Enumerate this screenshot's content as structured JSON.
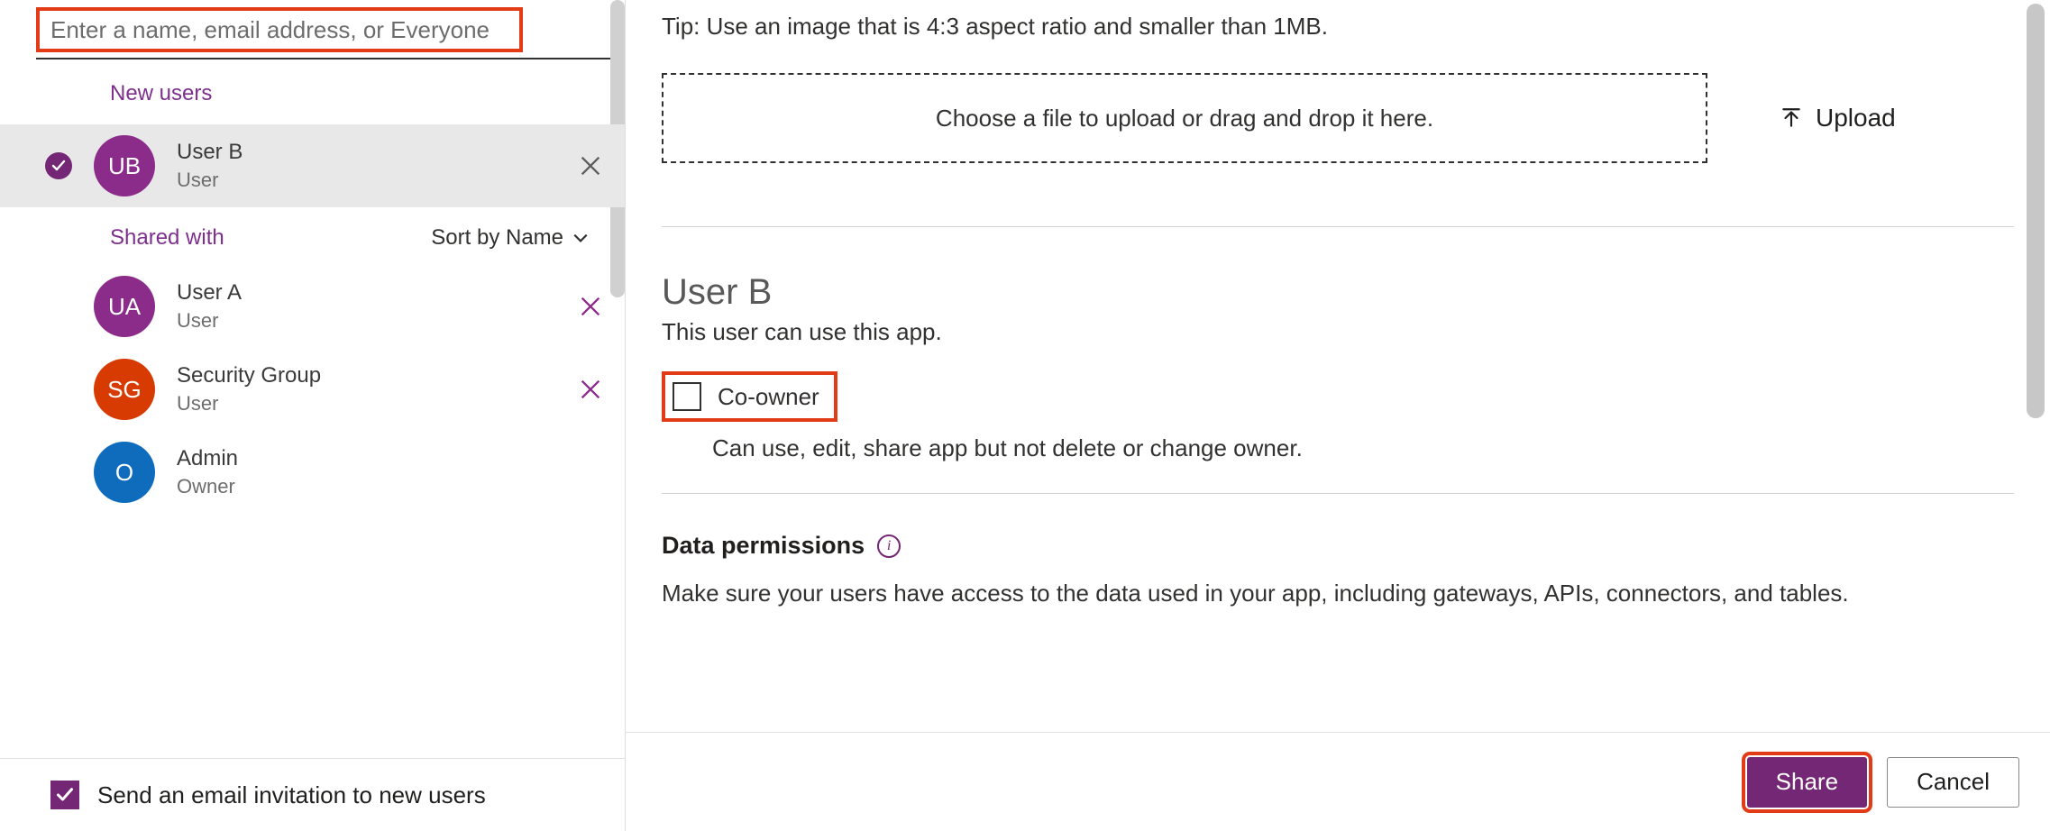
{
  "search": {
    "placeholder": "Enter a name, email address, or Everyone"
  },
  "sections": {
    "newUsersLabel": "New users",
    "sharedWithLabel": "Shared with",
    "sortLabel": "Sort by Name"
  },
  "people": {
    "selected": {
      "initials": "UB",
      "name": "User B",
      "role": "User"
    },
    "shared": [
      {
        "initials": "UA",
        "name": "User A",
        "role": "User",
        "avatarClass": "av-purple",
        "removable": true
      },
      {
        "initials": "SG",
        "name": "Security Group",
        "role": "User",
        "avatarClass": "av-red",
        "removable": true
      },
      {
        "initials": "O",
        "name": "Admin",
        "role": "Owner",
        "avatarClass": "av-blue",
        "removable": false
      }
    ]
  },
  "emailInvite": {
    "label": "Send an email invitation to new users"
  },
  "imageTip": "Tip: Use an image that is 4:3 aspect ratio and smaller than 1MB.",
  "dropzone": {
    "text": "Choose a file to upload or drag and drop it here."
  },
  "uploadLabel": "Upload",
  "detail": {
    "title": "User B",
    "subtitle": "This user can use this app.",
    "coOwnerLabel": "Co-owner",
    "coOwnerDesc": "Can use, edit, share app but not delete or change owner."
  },
  "dataPerms": {
    "title": "Data permissions",
    "desc": "Make sure your users have access to the data used in your app, including gateways, APIs, connectors, and tables."
  },
  "footer": {
    "share": "Share",
    "cancel": "Cancel"
  }
}
